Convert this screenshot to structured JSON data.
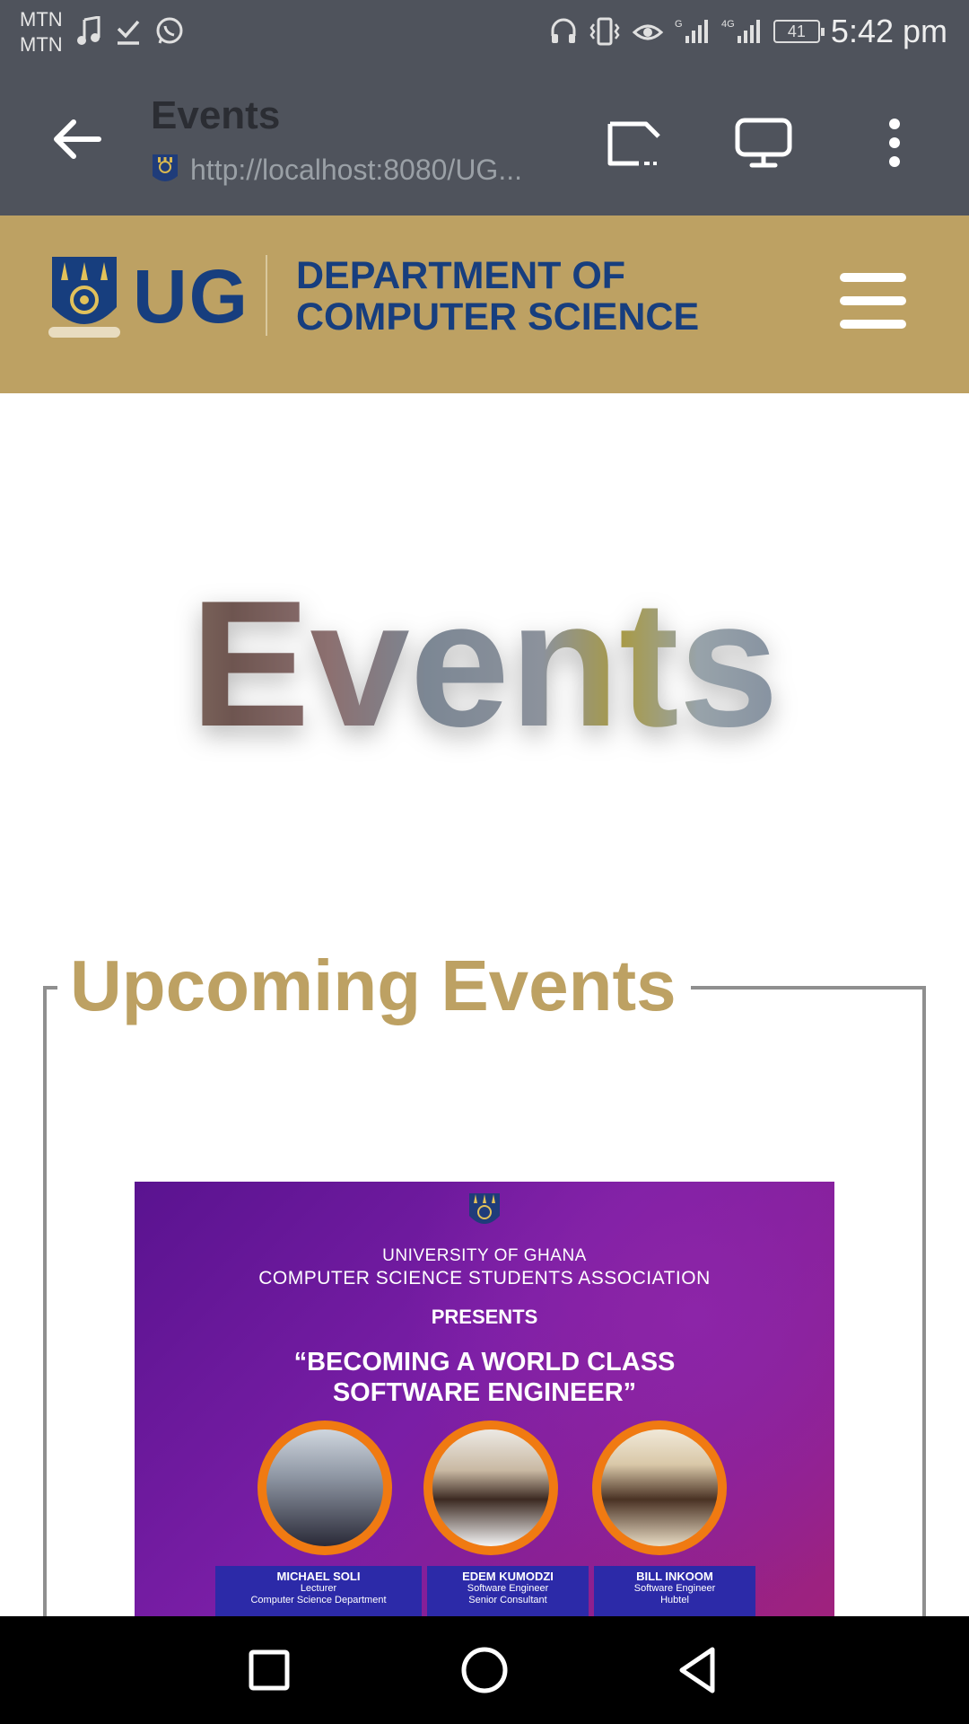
{
  "status_bar": {
    "carrier1": "MTN",
    "carrier2": "MTN",
    "battery": "41",
    "time": "5:42 pm"
  },
  "browser": {
    "page_title": "Events",
    "url": "http://localhost:8080/UG..."
  },
  "site_header": {
    "logo_text": "UG",
    "dept_line1": "DEPARTMENT OF",
    "dept_line2": "COMPUTER SCIENCE"
  },
  "hero": {
    "title": "Events"
  },
  "events": {
    "heading": "Upcoming Events",
    "poster": {
      "university": "UNIVERSITY OF GHANA",
      "association": "COMPUTER SCIENCE STUDENTS ASSOCIATION",
      "presents": "PRESENTS",
      "headline1": "“BECOMING A WORLD CLASS",
      "headline2": "SOFTWARE ENGINEER”",
      "speakers": [
        {
          "name": "MICHAEL SOLI",
          "role1": "Lecturer",
          "role2": "Computer Science Department"
        },
        {
          "name": "EDEM KUMODZI",
          "role1": "Software Engineer",
          "role2": "Senior Consultant"
        },
        {
          "name": "BILL INKOOM",
          "role1": "Software Engineer",
          "role2": "Hubtel"
        }
      ]
    }
  },
  "colors": {
    "status_bar": "#4f535c",
    "header_gold": "#bda163",
    "ug_blue": "#173e7e",
    "box_border": "#8f8f8f",
    "poster_purple": "#6b1a9e",
    "speaker_orange": "#f07a12"
  }
}
